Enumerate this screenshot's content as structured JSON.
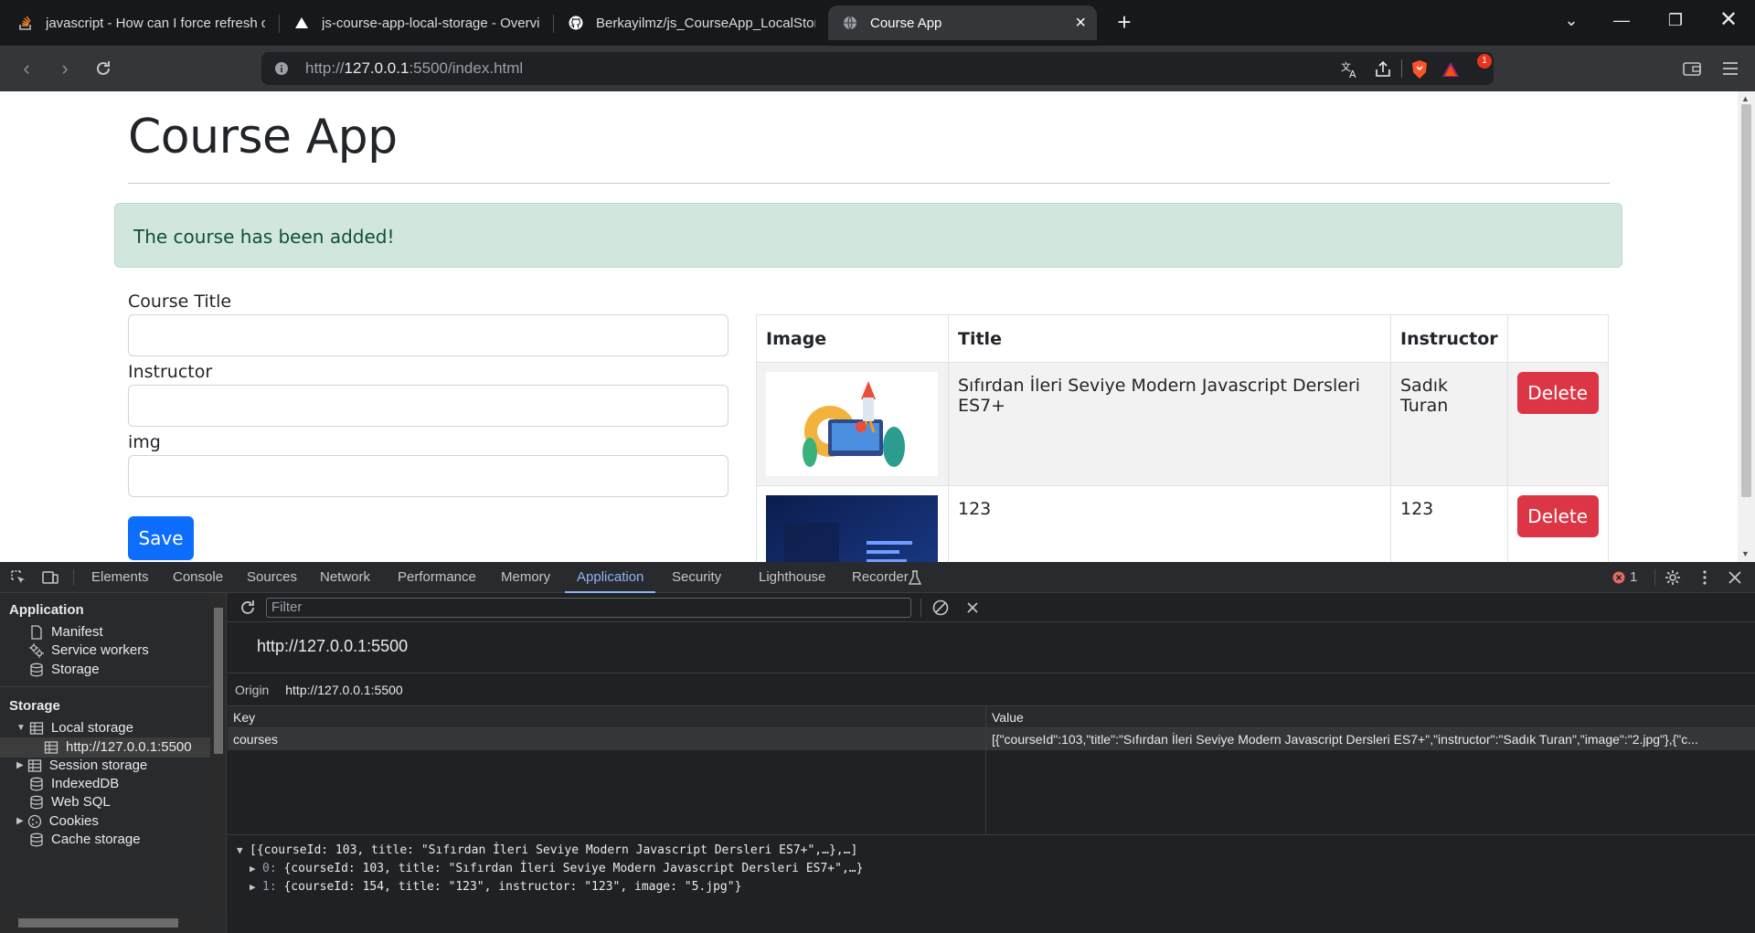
{
  "browser": {
    "tabs": [
      {
        "title": "javascript - How can I force refresh o",
        "icon": "stackoverflow-icon"
      },
      {
        "title": "js-course-app-local-storage - Overvi",
        "icon": "vercel-icon"
      },
      {
        "title": "Berkayilmz/js_CourseApp_LocalStora",
        "icon": "github-icon"
      },
      {
        "title": "Course App",
        "icon": "globe-icon",
        "active": true
      }
    ],
    "url_scheme": "http://",
    "url_host": "127.0.0.1",
    "url_rest": ":5500/index.html",
    "brave_badge": "1"
  },
  "page": {
    "heading": "Course App",
    "alert": "The course has been added!",
    "form": {
      "title_label": "Course Title",
      "instructor_label": "Instructor",
      "img_label": "img",
      "save_label": "Save"
    },
    "table": {
      "headers": [
        "Image",
        "Title",
        "Instructor",
        ""
      ],
      "rows": [
        {
          "title": "Sıfırdan İleri Seviye Modern Javascript Dersleri ES7+",
          "instructor": "Sadık Turan",
          "delete_label": "Delete"
        },
        {
          "title": "123",
          "instructor": "123",
          "delete_label": "Delete"
        }
      ]
    }
  },
  "devtools": {
    "tabs": [
      "Elements",
      "Console",
      "Sources",
      "Network",
      "Performance",
      "Memory",
      "Application",
      "Security",
      "Lighthouse",
      "Recorder"
    ],
    "active_tab": "Application",
    "error_count": "1",
    "sidebar": {
      "application_header": "Application",
      "application_items": [
        "Manifest",
        "Service workers",
        "Storage"
      ],
      "storage_header": "Storage",
      "storage_items": {
        "local_storage": "Local storage",
        "local_origin": "http://127.0.0.1:5500",
        "session_storage": "Session storage",
        "indexeddb": "IndexedDB",
        "websql": "Web SQL",
        "cookies": "Cookies",
        "cache_storage": "Cache storage"
      }
    },
    "filter_placeholder": "Filter",
    "origin_title": "http://127.0.0.1:5500",
    "origin_label": "Origin",
    "origin_value": "http://127.0.0.1:5500",
    "kv": {
      "key_header": "Key",
      "value_header": "Value",
      "rows": [
        {
          "key": "courses",
          "value": "[{\"courseId\":103,\"title\":\"Sıfırdan İleri Seviye Modern Javascript Dersleri ES7+\",\"instructor\":\"Sadık Turan\",\"image\":\"2.jpg\"},{\"c..."
        }
      ]
    },
    "preview": {
      "line0": "[{courseId: 103, title: \"Sıfırdan İleri Seviye Modern Javascript Dersleri ES7+\",…},…]",
      "line1_index": "0:",
      "line1": "{courseId: 103, title: \"Sıfırdan İleri Seviye Modern Javascript Dersleri ES7+\",…}",
      "line2_index": "1:",
      "line2": "{courseId: 154, title: \"123\", instructor: \"123\", image: \"5.jpg\"}"
    }
  }
}
